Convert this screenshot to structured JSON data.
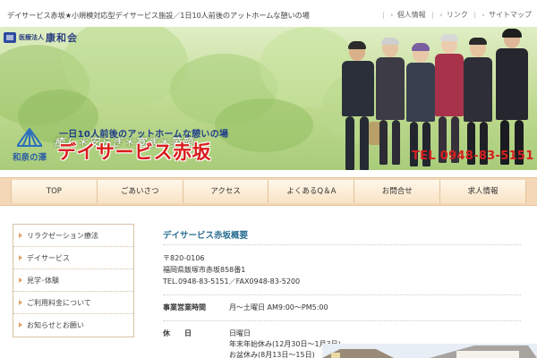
{
  "header": {
    "tagline": "デイサービス赤坂★小規模対応型デイサービス施設／1日10人前後のアットホームな憩いの場",
    "links": [
      "個人情報",
      "リンク",
      "サイトマップ"
    ]
  },
  "banner": {
    "org_prefix": "医療法人",
    "org_name": "康和会",
    "motto": "癒し＊安らぎ＊寛ぎ＊笑顔",
    "subcopy": "一日10人前後のアットホームな憩いの場",
    "title": "デイサービス赤坂",
    "brand_name": "和泉の澤",
    "phone": "TEL 0948-83-5151"
  },
  "nav": [
    "TOP",
    "ごあいさつ",
    "アクセス",
    "よくあるQ＆A",
    "お問合せ",
    "求人情報"
  ],
  "sidebar": {
    "items": [
      "リラクゼーション療法",
      "デイサービス",
      "見学･体験",
      "ご利用料金について",
      "お知らせとお願い"
    ]
  },
  "main": {
    "title": "デイサービス赤坂概要",
    "address": [
      "〒820-0106",
      "福岡県飯塚市赤坂858番1",
      "TEL.0948-83-5151／FAX0948-83-5200"
    ],
    "hours_label": "事業営業時間",
    "hours_value": "月〜土曜日 AM9:00〜PM5:00",
    "holiday_label": "休　　日",
    "holiday_values": [
      "日曜日",
      "年末年始休み(12月30日〜1月3日)",
      "お盆休み(8月13日〜15日)"
    ]
  },
  "colors": {
    "nav_bg": "#f3d7b7",
    "title_red": "#d91c1c",
    "accent_blue": "#2a6e92"
  }
}
